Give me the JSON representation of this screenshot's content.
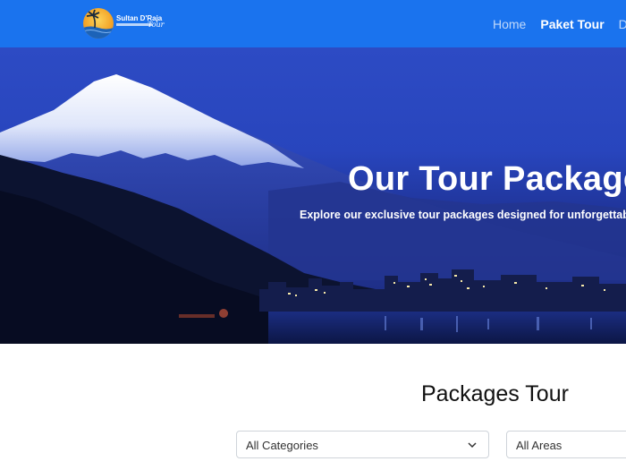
{
  "navbar": {
    "logo": {
      "text": "Sultan D'Raja",
      "script": "Tour"
    },
    "links": [
      {
        "label": "Home",
        "active": false
      },
      {
        "label": "Paket Tour",
        "active": true
      },
      {
        "label": "Dest",
        "active": false
      }
    ]
  },
  "hero": {
    "title": "Our Tour Packages",
    "subtitle": "Explore our exclusive tour packages designed for unforgettable"
  },
  "packages": {
    "title": "Packages Tour",
    "filters": {
      "category": {
        "value": "All Categories"
      },
      "area": {
        "value": "All Areas"
      }
    }
  },
  "colors": {
    "navbar": "#1a73ee",
    "hero_sky": "#2845bd"
  }
}
